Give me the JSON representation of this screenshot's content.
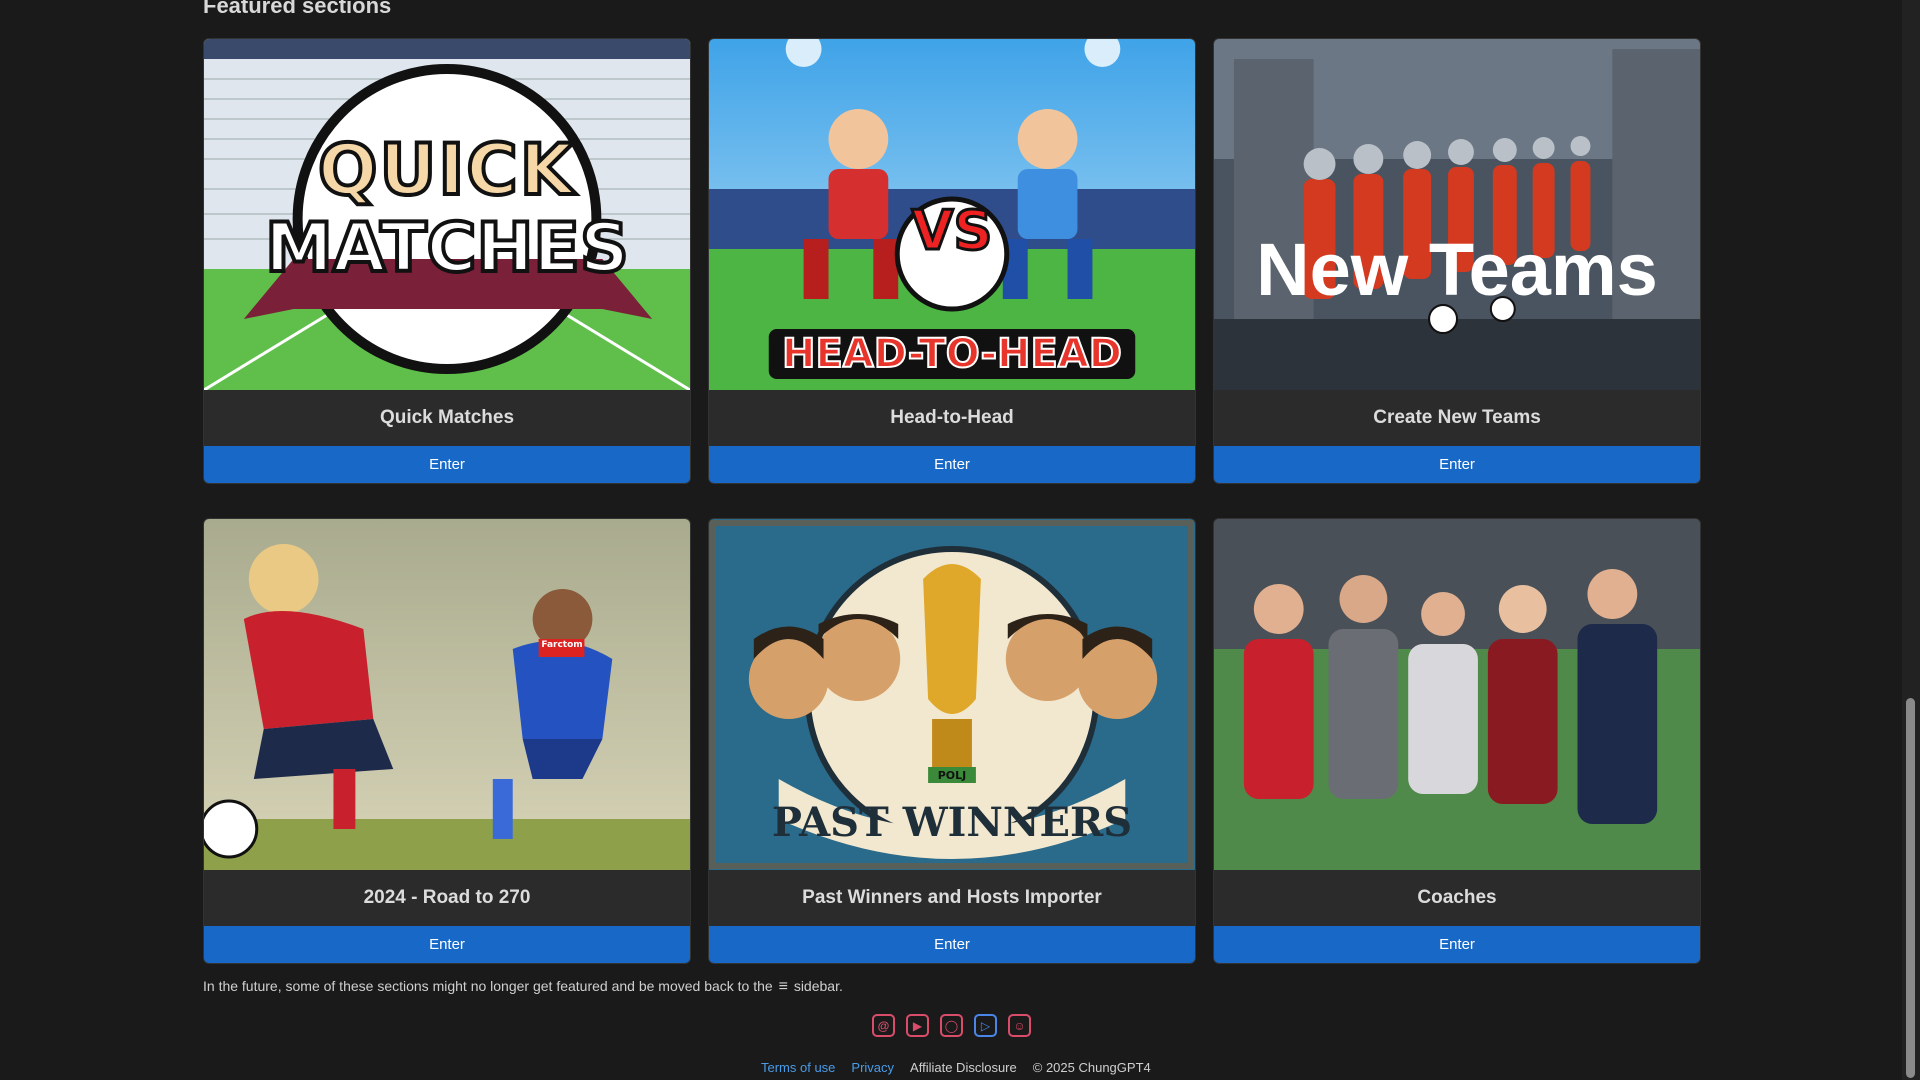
{
  "section": {
    "title": "Featured sections"
  },
  "cards": [
    {
      "title": "Quick Matches",
      "button": "Enter",
      "art": [
        "QUICK",
        "MATCHES"
      ]
    },
    {
      "title": "Head-to-Head",
      "button": "Enter",
      "art": [
        "VS",
        "HEAD-TO-HEAD"
      ]
    },
    {
      "title": "Create New Teams",
      "button": "Enter",
      "art": [
        "New Teams"
      ]
    },
    {
      "title": "2024 - Road to 270",
      "button": "Enter",
      "art": [
        "Farctom"
      ]
    },
    {
      "title": "Past Winners and Hosts Importer",
      "button": "Enter",
      "art": [
        "PAST WINNERS",
        "POLJ"
      ]
    },
    {
      "title": "Coaches",
      "button": "Enter",
      "art": []
    }
  ],
  "note": {
    "before": "In the future, some of these sections might no longer get featured and be moved back to the",
    "icon": "menu-icon",
    "after": "sidebar."
  },
  "socials": [
    "threads-icon",
    "youtube-icon",
    "instagram-icon",
    "play-store-icon",
    "reddit-icon"
  ],
  "footer": {
    "terms": "Terms of use",
    "privacy": "Privacy",
    "affiliate": "Affiliate Disclosure",
    "copyright": "© 2025 ChungGPT4"
  },
  "colors": {
    "button": "#1768c7",
    "link": "#4a9be8",
    "social": "#d94c6a"
  }
}
